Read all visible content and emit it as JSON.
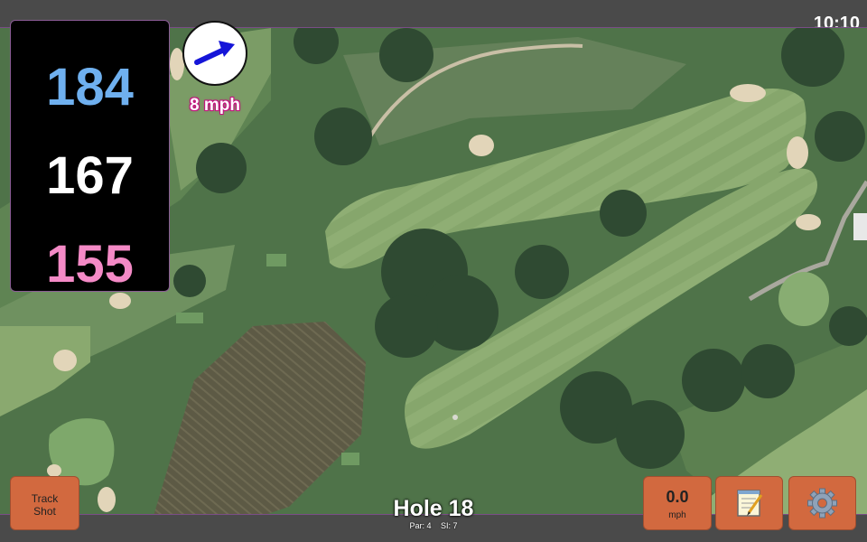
{
  "status": {
    "time": "10:10"
  },
  "distances": {
    "back": "184",
    "middle": "167",
    "front": "155"
  },
  "wind": {
    "speed_label": "8 mph",
    "icon": "arrow-right-up-icon"
  },
  "hole": {
    "title": "Hole 18",
    "par_label": "Par: 4",
    "si_label": "SI: 7"
  },
  "buttons": {
    "track_shot_line1": "Track",
    "track_shot_line2": "Shot",
    "speed_value": "0.0",
    "speed_unit": "mph",
    "notes_icon": "notepad-icon",
    "settings_icon": "gear-icon"
  },
  "colors": {
    "back": "#6fb0ef",
    "middle": "#ffffff",
    "front": "#f48ac6",
    "button": "#d2693f",
    "panel_border": "#8a5b95"
  }
}
